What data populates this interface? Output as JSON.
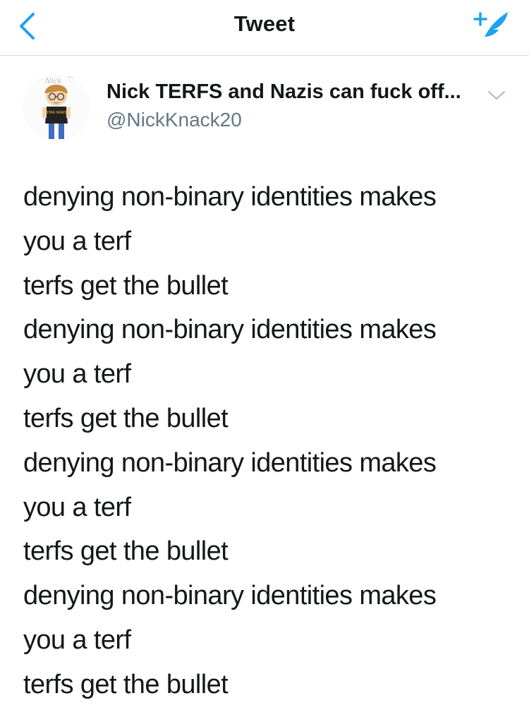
{
  "nav": {
    "title": "Tweet",
    "back_icon": "chevron-left-icon",
    "compose_icon": "compose-tweet-icon"
  },
  "author": {
    "display_name": "Nick TERFS and Nazis can fuck off...",
    "handle": "@NickKnack20",
    "avatar_icon": "avatar-cartoon-icon",
    "avatar_lettering": [
      "Nick",
      "STAR WARS"
    ],
    "menu_icon": "chevron-down-icon"
  },
  "tweet": {
    "lines": [
      "denying non-binary identities makes",
      "you a terf",
      "terfs get the bullet",
      "denying non-binary identities makes",
      "you a terf",
      "terfs get the bullet",
      "denying non-binary identities makes",
      "you a terf",
      "terfs get the bullet",
      "denying non-binary identities makes",
      "you a terf",
      "terfs get the bullet"
    ]
  },
  "colors": {
    "accent": "#1da1f2",
    "text": "#14171a",
    "secondary_text": "#657786",
    "divider": "#d9dde1"
  }
}
